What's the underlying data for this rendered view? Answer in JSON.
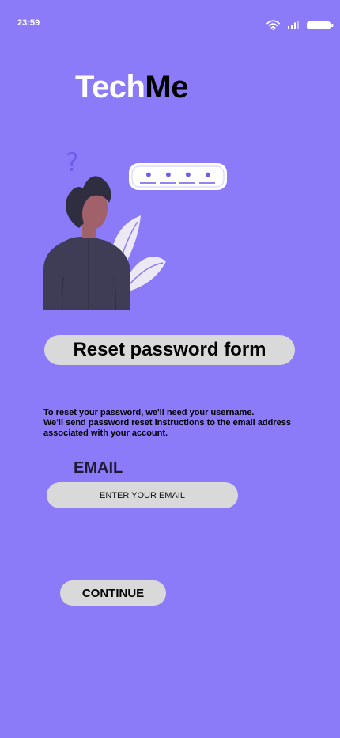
{
  "status_bar": {
    "time": "23:59",
    "icons": [
      "wifi-icon",
      "signal-icon",
      "battery-icon"
    ]
  },
  "logo": {
    "part1": "Tech",
    "part2": "Me"
  },
  "illustration": {
    "question_mark": "?",
    "password_dots": [
      "•",
      "•",
      "•",
      "•"
    ]
  },
  "form": {
    "title": "Reset password form",
    "description_line1": "To reset your password, we'll need your username.",
    "description_line2": "We'll send password reset instructions to the email address associated with your account.",
    "email_label": "EMAIL",
    "email_placeholder": "ENTER YOUR EMAIL",
    "email_value": "",
    "continue_label": "CONTINUE"
  },
  "colors": {
    "background": "#8c7bf8",
    "pill": "#d9d9d9",
    "logo_primary": "#ffffff",
    "logo_secondary": "#000000"
  }
}
